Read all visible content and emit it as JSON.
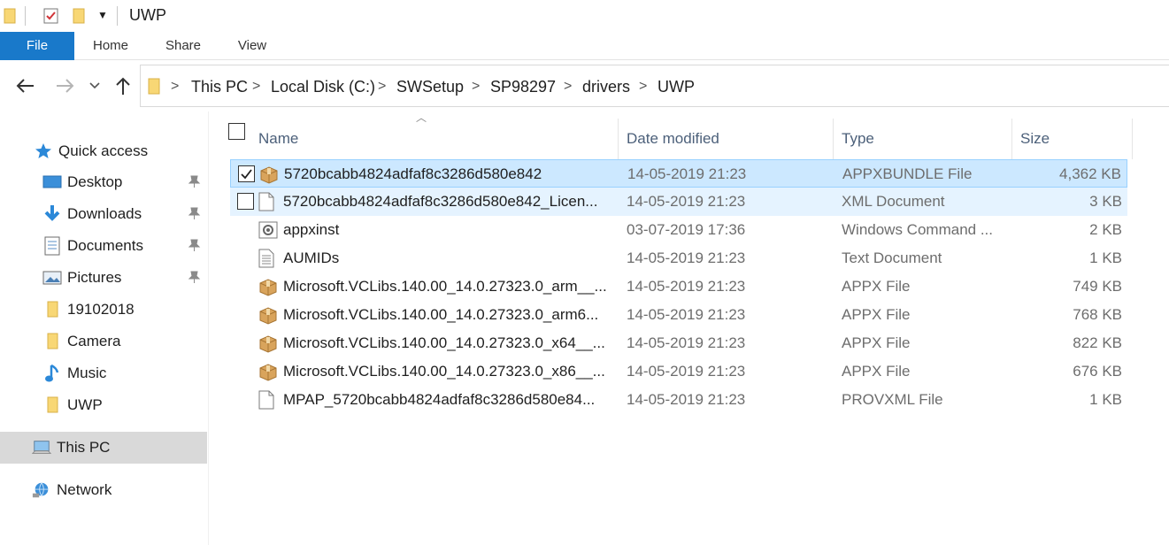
{
  "window": {
    "title": "UWP"
  },
  "ribbon": {
    "tabs": [
      "File",
      "Home",
      "Share",
      "View"
    ]
  },
  "address": {
    "crumbs": [
      "This PC",
      "Local Disk (C:)",
      "SWSetup",
      "SP98297",
      "drivers",
      "UWP"
    ]
  },
  "sidebar": {
    "quick_access": "Quick access",
    "items": [
      {
        "label": "Desktop",
        "icon": "desktop-icon",
        "pinned": true
      },
      {
        "label": "Downloads",
        "icon": "downloads-icon",
        "pinned": true
      },
      {
        "label": "Documents",
        "icon": "documents-icon",
        "pinned": true
      },
      {
        "label": "Pictures",
        "icon": "pictures-icon",
        "pinned": true
      },
      {
        "label": "19102018",
        "icon": "folder-icon",
        "pinned": false
      },
      {
        "label": "Camera",
        "icon": "folder-icon",
        "pinned": false
      },
      {
        "label": "Music",
        "icon": "music-icon",
        "pinned": false
      },
      {
        "label": "UWP",
        "icon": "folder-icon",
        "pinned": false
      }
    ],
    "this_pc": "This PC",
    "network": "Network"
  },
  "columns": {
    "name": "Name",
    "date": "Date modified",
    "type": "Type",
    "size": "Size"
  },
  "files": [
    {
      "name": "5720bcabb4824adfaf8c3286d580e842",
      "date": "14-05-2019 21:23",
      "type": "APPXBUNDLE File",
      "size": "4,362 KB",
      "icon": "package-icon"
    },
    {
      "name": "5720bcabb4824adfaf8c3286d580e842_Licen...",
      "date": "14-05-2019 21:23",
      "type": "XML Document",
      "size": "3 KB",
      "icon": "document-icon"
    },
    {
      "name": "appxinst",
      "date": "03-07-2019 17:36",
      "type": "Windows Command ...",
      "size": "2 KB",
      "icon": "script-icon"
    },
    {
      "name": "AUMIDs",
      "date": "14-05-2019 21:23",
      "type": "Text Document",
      "size": "1 KB",
      "icon": "text-file-icon"
    },
    {
      "name": "Microsoft.VCLibs.140.00_14.0.27323.0_arm__...",
      "date": "14-05-2019 21:23",
      "type": "APPX File",
      "size": "749 KB",
      "icon": "package-icon"
    },
    {
      "name": "Microsoft.VCLibs.140.00_14.0.27323.0_arm6...",
      "date": "14-05-2019 21:23",
      "type": "APPX File",
      "size": "768 KB",
      "icon": "package-icon"
    },
    {
      "name": "Microsoft.VCLibs.140.00_14.0.27323.0_x64__...",
      "date": "14-05-2019 21:23",
      "type": "APPX File",
      "size": "822 KB",
      "icon": "package-icon"
    },
    {
      "name": "Microsoft.VCLibs.140.00_14.0.27323.0_x86__...",
      "date": "14-05-2019 21:23",
      "type": "APPX File",
      "size": "676 KB",
      "icon": "package-icon"
    },
    {
      "name": "MPAP_5720bcabb4824adfaf8c3286d580e84...",
      "date": "14-05-2019 21:23",
      "type": "PROVXML File",
      "size": "1 KB",
      "icon": "document-icon"
    }
  ],
  "colors": {
    "accent": "#1979ca",
    "selection": "#cce8ff",
    "hover": "#e5f3ff",
    "folder": "#f8d775"
  }
}
